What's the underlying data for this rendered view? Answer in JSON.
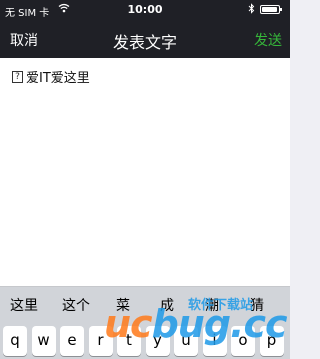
{
  "status_bar": {
    "carrier": "无 SIM 卡",
    "time": "10:00",
    "battery_level": 0.95
  },
  "nav": {
    "cancel_label": "取消",
    "title": "发表文字",
    "send_label": "发送",
    "send_color": "#36b63a"
  },
  "compose": {
    "content": "爱IT爱这里"
  },
  "suggestions": [
    "这里",
    "这个",
    "菜",
    "成",
    "潮",
    "猜"
  ],
  "keyboard": {
    "row1": [
      "q",
      "w",
      "e",
      "r",
      "t",
      "y",
      "u",
      "i",
      "o",
      "p"
    ]
  },
  "watermark": {
    "logo_left": "uc",
    "logo_right": "bug.cc",
    "cn": "软件下载站"
  }
}
